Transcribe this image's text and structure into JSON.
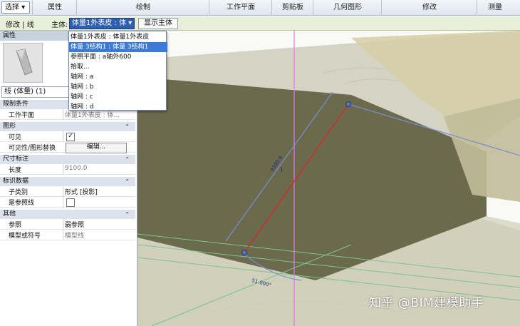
{
  "ribbon": {
    "select_label": "选择 ▾",
    "panels": [
      "属性",
      "绘制",
      "工作平面",
      "剪贴板",
      "几何图形",
      "修改",
      "测量"
    ]
  },
  "context_bar": {
    "mode_label": "修改 | 线",
    "host_label": "主体:",
    "host_value": "体量1外表皮 : 体 ▾",
    "show_host_button": "显示主体"
  },
  "host_dropdown": {
    "items": [
      "体量1外表皮 : 体量1外表皮",
      "体量 3结构1 : 体量 3结构1",
      "参照平面 : a轴外600",
      "拾取...",
      "轴网 : a",
      "轴网 : b",
      "轴网 : c",
      "轴网 : d"
    ],
    "selected_index": 1
  },
  "properties": {
    "title": "属性",
    "type_selector": "线 (体量) (1)",
    "sections": {
      "constraints": "限制条件",
      "graphics": "图形",
      "dimensions": "尺寸标注",
      "identity": "标识数据",
      "other": "其他"
    },
    "rows": {
      "work_plane_key": "工作平面",
      "work_plane_val": "体量1外表皮 : 体...",
      "visible_key": "可见",
      "visible_checked": true,
      "vis_override_key": "可见性/图形替换",
      "edit_button": "编辑...",
      "length_key": "长度",
      "length_val": "9100.0",
      "subcategory_key": "子类别",
      "subcategory_val": "形式 [投影]",
      "is_ref_key": "是参照线",
      "is_ref_checked": false,
      "reference_key": "参照",
      "reference_val": "弱参照",
      "model_or_symbolic_key": "模型或符号",
      "model_or_symbolic_val": "模型线"
    }
  },
  "canvas": {
    "dimension_text": "9100.0",
    "angle_text": "51.000°",
    "colors": {
      "roof_surface": "#a9a88f",
      "dark_plane": "#6e6c4f",
      "selected_line": "#d12a2a",
      "blue_guides": "#6f86c8",
      "green_lines": "#7ac48b",
      "magenta_axis": "#e06be0"
    }
  },
  "watermark": "知乎 @BIM建模助手"
}
